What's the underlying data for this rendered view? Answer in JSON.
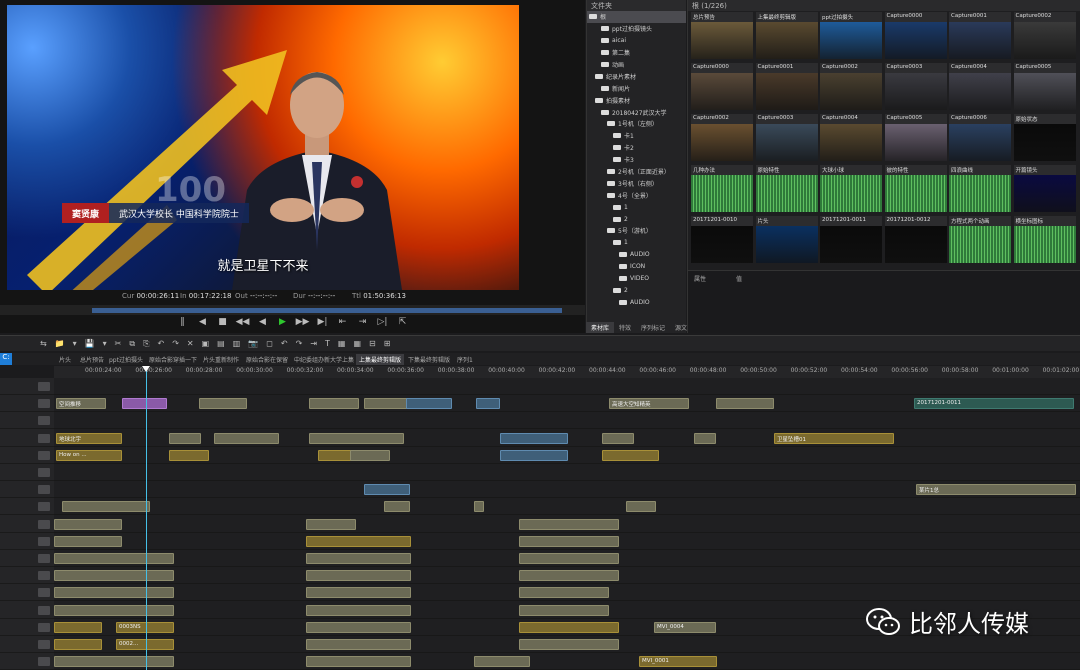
{
  "preview": {
    "lower_third_name": "窦贤康",
    "lower_third_title": "武汉大学校长  中国科学院院士",
    "subtitle": "就是卫星下不来",
    "background_number": "100",
    "timecodes": [
      {
        "label": "Cur",
        "value": "00:00:26:11"
      },
      {
        "label": "In",
        "value": "00:17:22:18"
      },
      {
        "label": "Out",
        "value": "--:--:--:--"
      },
      {
        "label": "Dur",
        "value": "--:--:--:--"
      },
      {
        "label": "Ttl",
        "value": "01:50:36:13"
      }
    ],
    "transport": [
      "‖",
      "◀",
      "■",
      "◀◀",
      "◀",
      "▶",
      "▶▶",
      "▶|",
      "⇤",
      "⇥",
      "▷|",
      "⇱"
    ]
  },
  "folders": {
    "header": "文件夹",
    "items": [
      {
        "label": "根",
        "selected": true
      },
      {
        "label": "ppt过拍摄镜头"
      },
      {
        "label": "aicai"
      },
      {
        "label": "第二集"
      },
      {
        "label": "动画"
      },
      {
        "label": "纪录片素材"
      },
      {
        "label": "新闻片"
      },
      {
        "label": "拍摄素材"
      },
      {
        "label": "20180427武汉大学"
      },
      {
        "label": "1号机（左侧）"
      },
      {
        "label": "卡1"
      },
      {
        "label": "卡2"
      },
      {
        "label": "卡3"
      },
      {
        "label": "2号机（正面近景）"
      },
      {
        "label": "3号机（右侧）"
      },
      {
        "label": "4号（全景）"
      },
      {
        "label": "1"
      },
      {
        "label": "2"
      },
      {
        "label": "5号（游机）"
      },
      {
        "label": "1"
      },
      {
        "label": "AUDIO"
      },
      {
        "label": "ICON"
      },
      {
        "label": "VIDEO"
      },
      {
        "label": "2"
      },
      {
        "label": "AUDIO"
      }
    ],
    "tabs": [
      "素材库",
      "特效",
      "序列标记",
      "源文件浏览"
    ]
  },
  "bin": {
    "header": "根 (1/226)",
    "thumbs": [
      {
        "label": "总片预告",
        "color": "#6b5a3a"
      },
      {
        "label": "上集最终剪辑版",
        "color": "#5a4a30"
      },
      {
        "label": "ppt过拍摄头",
        "color": "#1e5b9a"
      },
      {
        "label": "Capture0000",
        "color": "#1a3a6a"
      },
      {
        "label": "Capture0001",
        "color": "#2a3a5a"
      },
      {
        "label": "Capture0002",
        "color": "#3a3a3a"
      },
      {
        "label": "Capture0000",
        "color": "#5a4a3a"
      },
      {
        "label": "Capture0001",
        "color": "#4a3a2a"
      },
      {
        "label": "Capture0002",
        "color": "#4a4030"
      },
      {
        "label": "Capture0003",
        "color": "#3a3a40"
      },
      {
        "label": "Capture0004",
        "color": "#40404a"
      },
      {
        "label": "Capture0005",
        "color": "#505058"
      },
      {
        "label": "Capture0002",
        "color": "#6a5030"
      },
      {
        "label": "Capture0003",
        "color": "#3a4a5a"
      },
      {
        "label": "Capture0004",
        "color": "#5a4a30"
      },
      {
        "label": "Capture0005",
        "color": "#6a6070"
      },
      {
        "label": "Capture0006",
        "color": "#2a4060"
      },
      {
        "label": "原始状态",
        "color": "#0a0a0a"
      },
      {
        "label": "几种办法",
        "color": "#2f7a3a"
      },
      {
        "label": "原始特性",
        "color": "#2f7a3a"
      },
      {
        "label": "大球小球",
        "color": "#2f7a3a"
      },
      {
        "label": "彼的特性",
        "color": "#2f7a3a"
      },
      {
        "label": "四浪曲线",
        "color": "#2f7a3a"
      },
      {
        "label": "开篇镜头",
        "color": "#0a0a40"
      },
      {
        "label": "20171201-0010",
        "color": "#0a0a0a"
      },
      {
        "label": "片头",
        "color": "#0a3060"
      },
      {
        "label": "20171201-0011",
        "color": "#0a0a0a"
      },
      {
        "label": "20171201-0012",
        "color": "#0a0a0a"
      },
      {
        "label": "方程式两个动画",
        "color": "#2f7a3a"
      },
      {
        "label": "横坐标图标",
        "color": "#2f7a3a"
      }
    ],
    "props": {
      "col1": "属性",
      "col2": "值"
    }
  },
  "timeline": {
    "toolbar": [
      "⇆",
      "📁",
      "▾",
      "💾",
      "▾",
      "✂",
      "⧉",
      "⎘",
      "↶",
      "↷",
      "✕",
      "▣",
      "▤",
      "▥",
      "📷",
      "◻",
      "↶",
      "↷",
      "⇥",
      "T",
      "▦",
      "▦",
      "⊟",
      "⊞"
    ],
    "sequence_tabs": [
      {
        "label": "片头"
      },
      {
        "label": "总片预告"
      },
      {
        "label": "ppt过拍摄头"
      },
      {
        "label": "原始合影穿插一下"
      },
      {
        "label": "片头重新制作"
      },
      {
        "label": "原始合影在保留"
      },
      {
        "label": "中纪委组办新大学上集"
      },
      {
        "label": "上集最终剪辑版",
        "active": true
      },
      {
        "label": "下集最终剪辑版"
      },
      {
        "label": "序列1"
      }
    ],
    "ruler": [
      "00:00:24:00",
      "00:00:26:00",
      "00:00:28:00",
      "00:00:30:00",
      "00:00:32:00",
      "00:00:34:00",
      "00:00:36:00",
      "00:00:38:00",
      "00:00:40:00",
      "00:00:42:00",
      "00:00:44:00",
      "00:00:46:00",
      "00:00:48:00",
      "00:00:50:00",
      "00:00:52:00",
      "00:00:54:00",
      "00:00:56:00",
      "00:00:58:00",
      "00:01:00:00",
      "00:01:02:00"
    ],
    "clip_labels": {
      "c1": "空间推移",
      "c2": "高速大空知精英",
      "c3": "20171201-0011",
      "c4": "地球北宇",
      "c5": "How on ...",
      "c6": "卫星坠槽01",
      "c7": "某片1总",
      "c8": "0003NS",
      "c9": "0002...",
      "c10": "MVI_0004",
      "c11": "MVI_0001"
    }
  },
  "watermark": {
    "text": "比邻人传媒"
  }
}
